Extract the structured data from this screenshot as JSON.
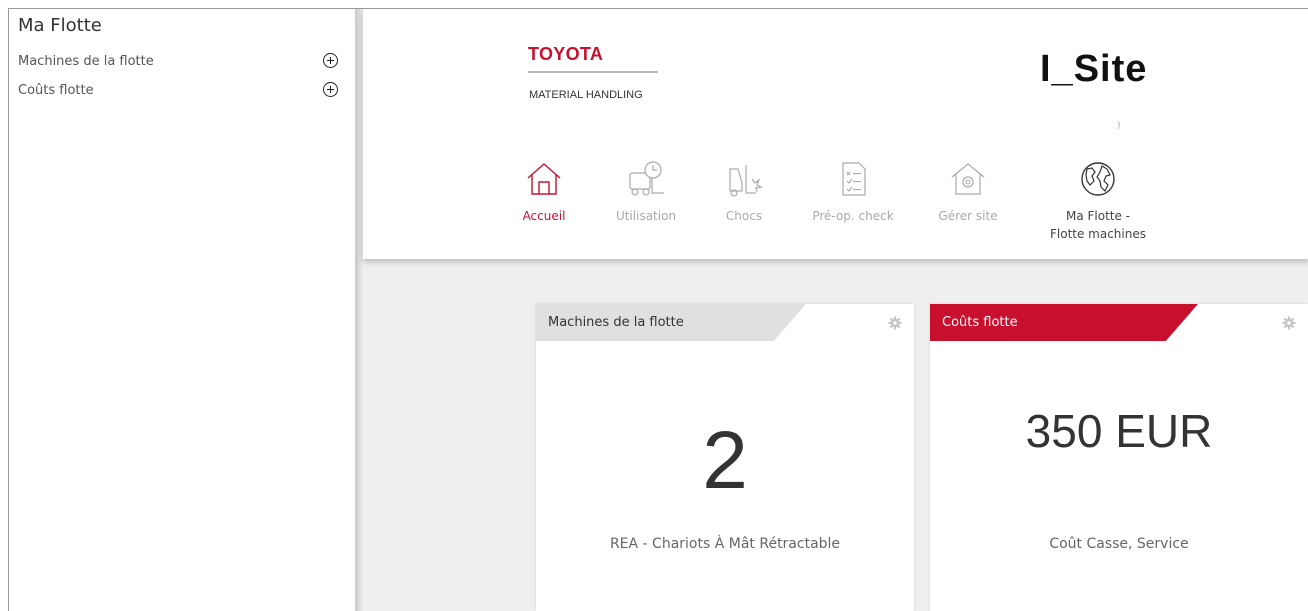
{
  "sidebar": {
    "title": "Ma Flotte",
    "items": [
      {
        "label": "Machines de la flotte",
        "icon": "plus-circle-icon"
      },
      {
        "label": "Coûts flotte",
        "icon": "plus-circle-icon"
      }
    ]
  },
  "header": {
    "brand": "TOYOTA",
    "brand_sub": "MATERIAL HANDLING",
    "app_logo": "I_Site",
    "brand_color": "#c8102e"
  },
  "nav": [
    {
      "label": "Accueil",
      "icon": "home-icon",
      "active": true
    },
    {
      "label": "Utilisation",
      "icon": "forklift-clock-icon",
      "active": false
    },
    {
      "label": "Chocs",
      "icon": "forklift-impact-icon",
      "active": false
    },
    {
      "label": "Pré-op. check",
      "icon": "checklist-icon",
      "active": false
    },
    {
      "label": "Gérer site",
      "icon": "site-settings-icon",
      "active": false
    },
    {
      "label": "Ma Flotte -",
      "label2": "Flotte machines",
      "icon": "globe-icon",
      "active": false
    }
  ],
  "cards": [
    {
      "title": "Machines de la flotte",
      "value": "2",
      "subtitle": "REA - Chariots À Mât Rétractable",
      "settings_icon": "gear-icon"
    },
    {
      "title": "Coûts flotte",
      "value": "350 EUR",
      "subtitle": "Coût Casse, Service",
      "settings_icon": "gear-icon"
    }
  ]
}
